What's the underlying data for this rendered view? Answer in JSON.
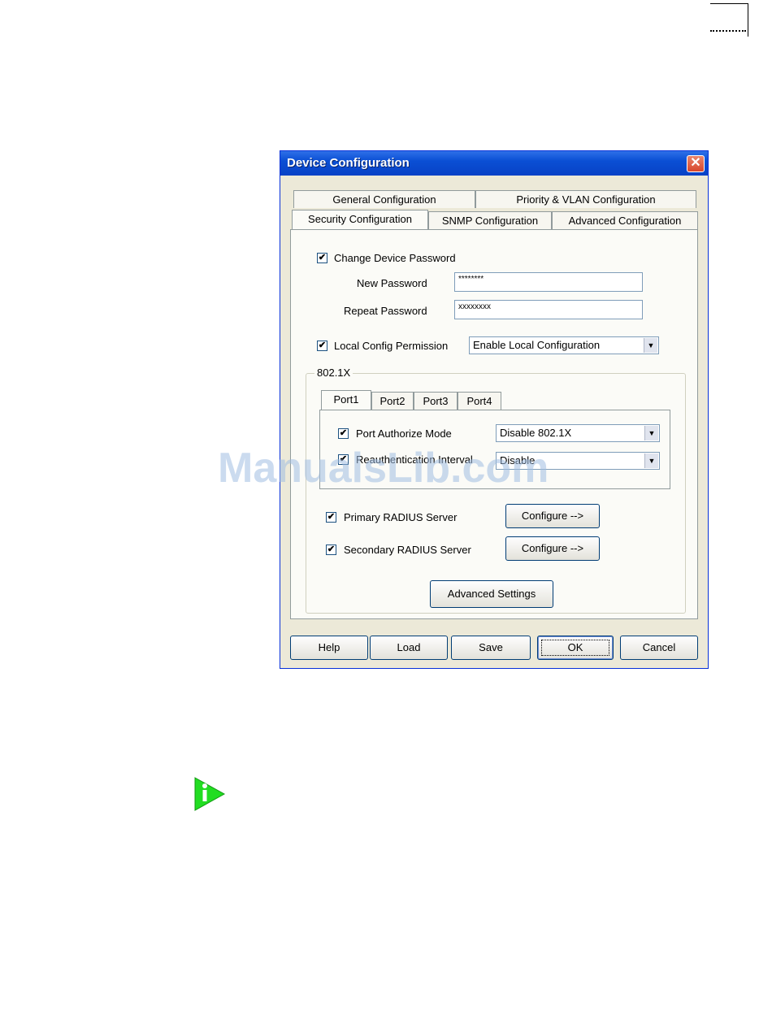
{
  "dialog": {
    "title": "Device Configuration",
    "close_glyph": "✕"
  },
  "tabs": {
    "row_back": [
      "General Configuration",
      "Priority & VLAN Configuration"
    ],
    "row_front": [
      "Security Configuration",
      "SNMP Configuration",
      "Advanced Configuration"
    ],
    "active": "Security Configuration"
  },
  "security": {
    "change_password_label": "Change Device Password",
    "change_password_checked": true,
    "new_password_label": "New Password",
    "new_password_value": "********",
    "repeat_password_label": "Repeat Password",
    "repeat_password_value": "xxxxxxxx",
    "local_config_label": "Local Config Permission",
    "local_config_checked": true,
    "local_config_value": "Enable Local Configuration"
  },
  "dot1x": {
    "group_label": "802.1X",
    "port_tabs": [
      "Port1",
      "Port2",
      "Port3",
      "Port4"
    ],
    "active_port": "Port1",
    "port_authorize_label": "Port Authorize Mode",
    "port_authorize_value": "Disable 802.1X",
    "reauth_label": "Reauthentication Interval",
    "reauth_value": "Disable",
    "primary_radius_label": "Primary RADIUS Server",
    "secondary_radius_label": "Secondary RADIUS Server",
    "configure_label": "Configure -->",
    "advanced_settings_label": "Advanced Settings"
  },
  "footer": {
    "help": "Help",
    "load": "Load",
    "save": "Save",
    "ok": "OK",
    "cancel": "Cancel"
  },
  "watermark": "ManualsLib.com",
  "icons": {
    "checkbox_mark": "✔",
    "dropdown_arrow": "▼"
  },
  "colors": {
    "titlebar": "#0a4fd4",
    "dialog_bg": "#ece9d8",
    "info_icon": "#22dd22"
  }
}
